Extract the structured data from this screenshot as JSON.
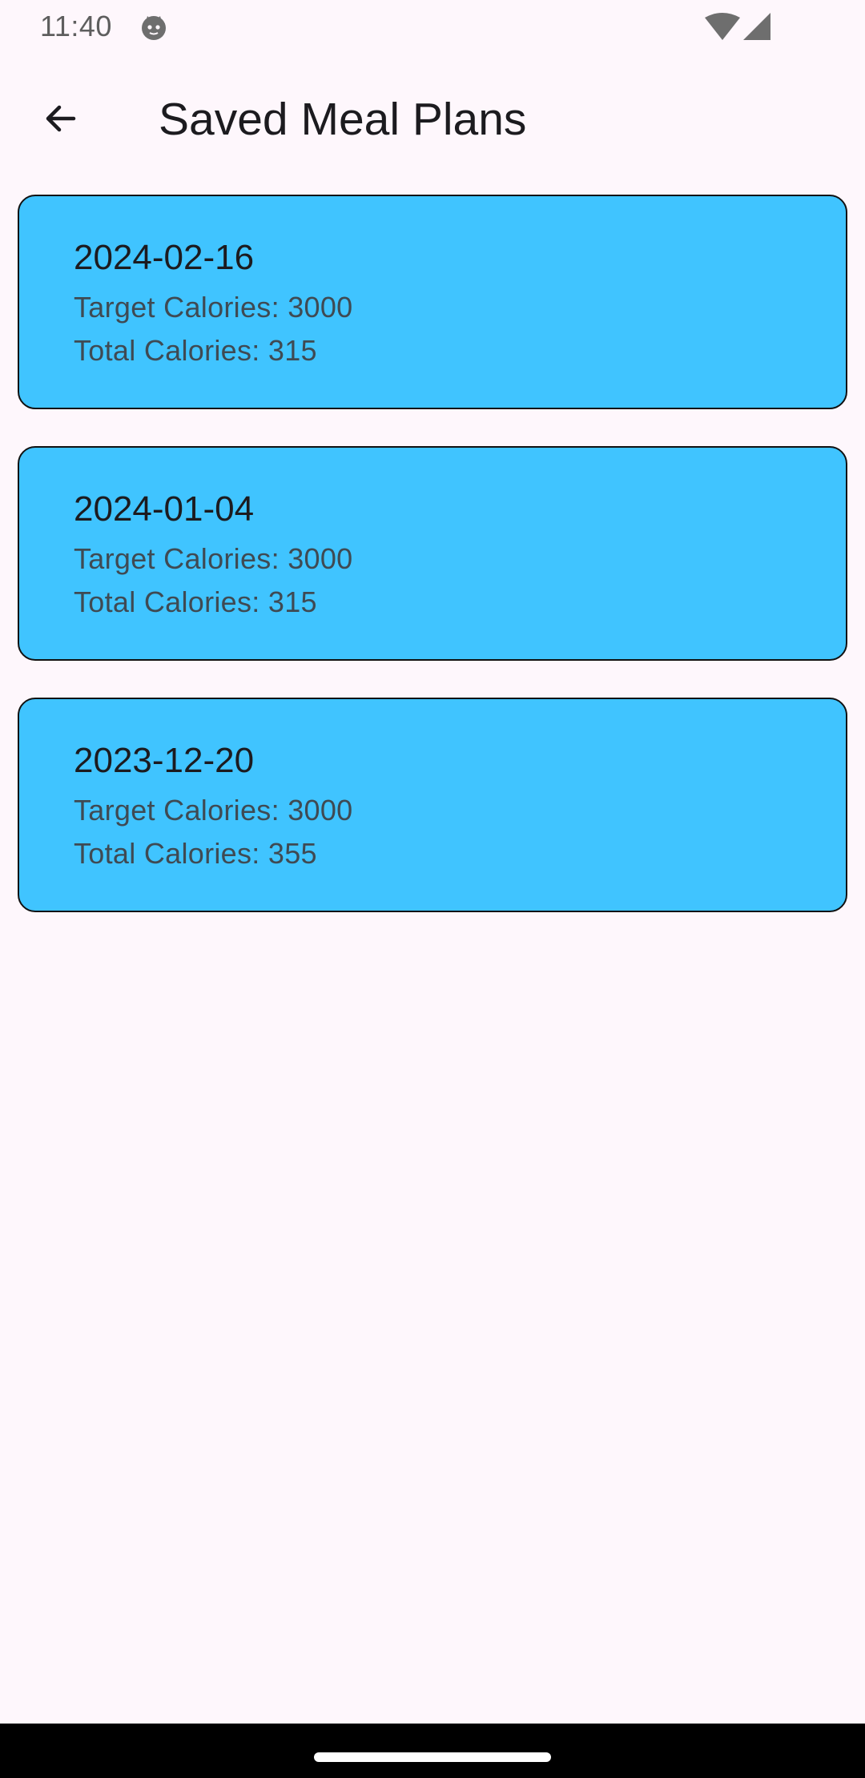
{
  "status_bar": {
    "time": "11:40",
    "icons": [
      "cat-notification-icon",
      "wifi-icon",
      "cell-signal-icon"
    ]
  },
  "app_bar": {
    "back_icon": "arrow-back-icon",
    "title": "Saved Meal Plans"
  },
  "colors": {
    "background": "#FEF7FC",
    "card": "#40C4FF",
    "card_border": "#111111"
  },
  "meal_plans": [
    {
      "date": "2024-02-16",
      "target": "Target Calories: 3000",
      "total": "Total Calories: 315"
    },
    {
      "date": "2024-01-04",
      "target": "Target Calories: 3000",
      "total": "Total Calories: 315"
    },
    {
      "date": "2023-12-20",
      "target": "Target Calories: 3000",
      "total": "Total Calories: 355"
    }
  ]
}
